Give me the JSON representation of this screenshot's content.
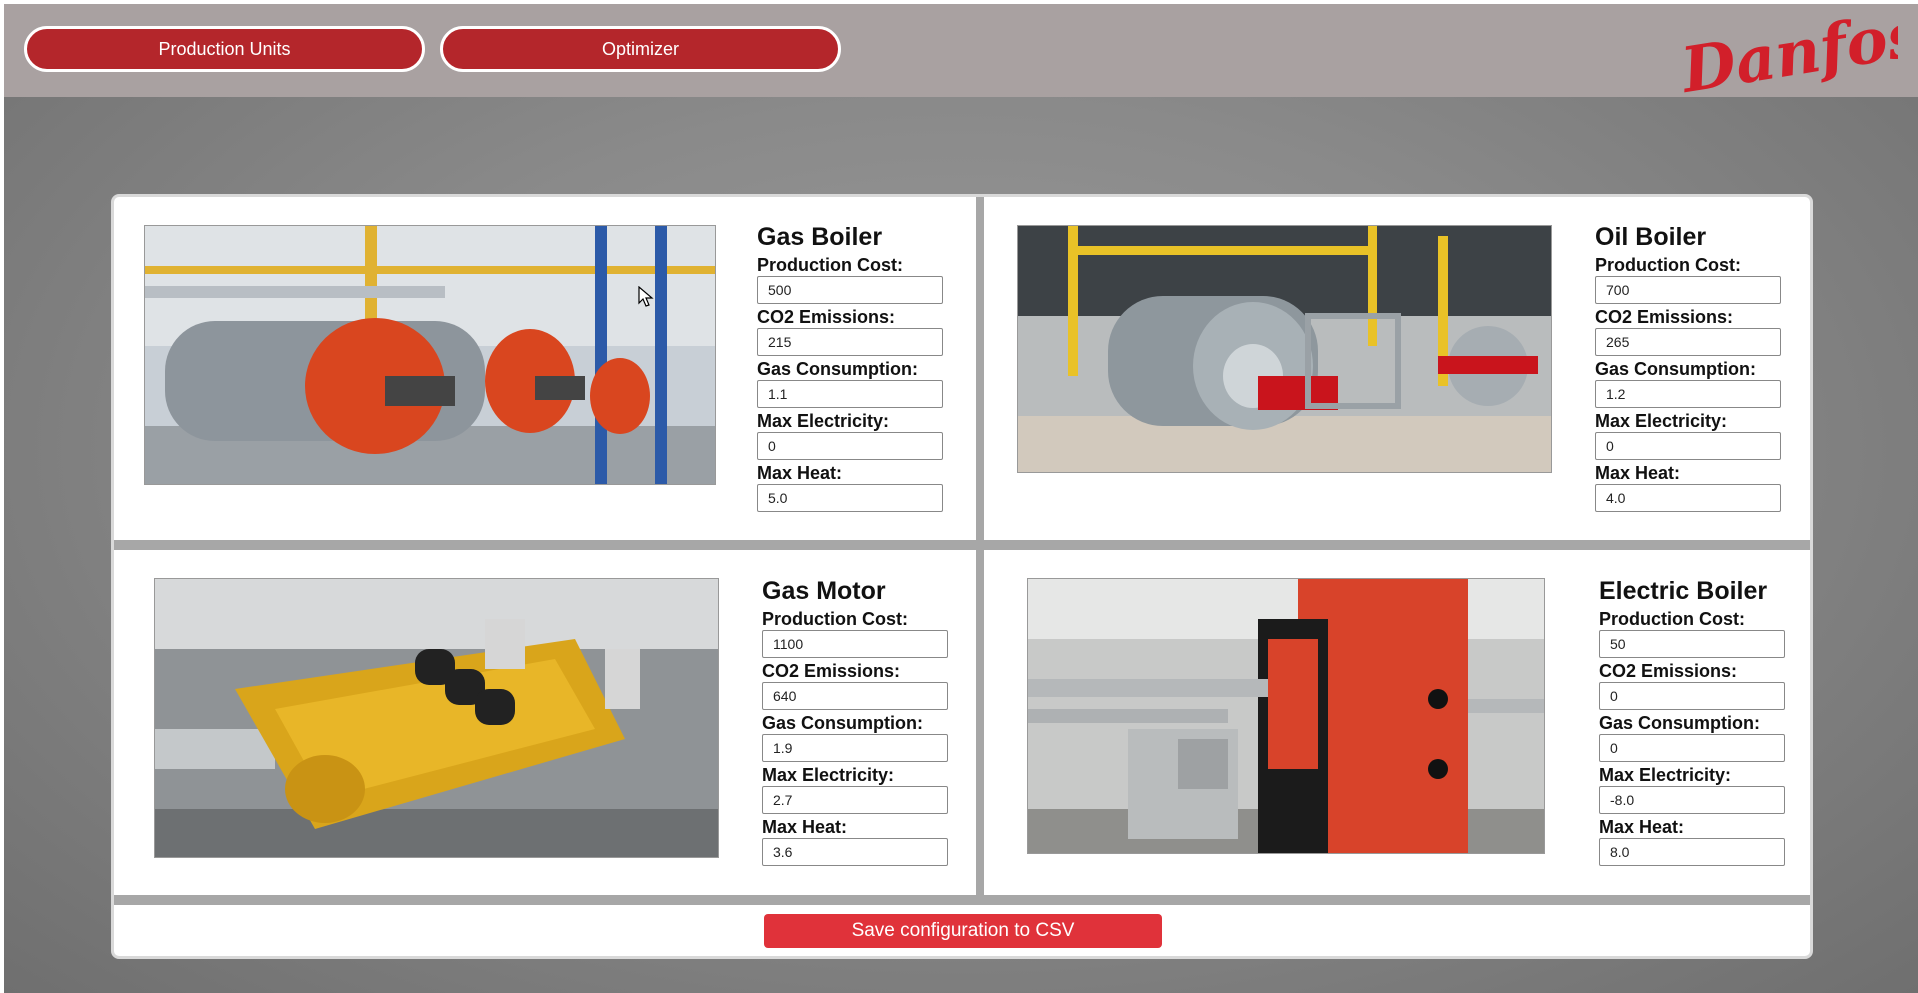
{
  "nav": {
    "production_units_label": "Production Units",
    "optimizer_label": "Optimizer"
  },
  "brand": {
    "logo_text": "Danfoss",
    "accent": "#b4262b"
  },
  "units": [
    {
      "name": "Gas Boiler",
      "fields": [
        {
          "label": "Production Cost:",
          "value": "500"
        },
        {
          "label": "CO2 Emissions:",
          "value": "215"
        },
        {
          "label": "Gas Consumption:",
          "value": "1.1"
        },
        {
          "label": "Max Electricity:",
          "value": "0"
        },
        {
          "label": "Max Heat:",
          "value": "5.0"
        }
      ]
    },
    {
      "name": "Oil Boiler",
      "fields": [
        {
          "label": "Production Cost:",
          "value": "700"
        },
        {
          "label": "CO2 Emissions:",
          "value": "265"
        },
        {
          "label": "Gas Consumption:",
          "value": "1.2"
        },
        {
          "label": "Max Electricity:",
          "value": "0"
        },
        {
          "label": "Max Heat:",
          "value": "4.0"
        }
      ]
    },
    {
      "name": "Gas Motor",
      "fields": [
        {
          "label": "Production Cost:",
          "value": "1100"
        },
        {
          "label": "CO2 Emissions:",
          "value": "640"
        },
        {
          "label": "Gas Consumption:",
          "value": "1.9"
        },
        {
          "label": "Max Electricity:",
          "value": "2.7"
        },
        {
          "label": "Max Heat:",
          "value": "3.6"
        }
      ]
    },
    {
      "name": "Electric Boiler",
      "fields": [
        {
          "label": "Production Cost:",
          "value": "50"
        },
        {
          "label": "CO2 Emissions:",
          "value": "0"
        },
        {
          "label": "Gas Consumption:",
          "value": "0"
        },
        {
          "label": "Max Electricity:",
          "value": "-8.0"
        },
        {
          "label": "Max Heat:",
          "value": "8.0"
        }
      ]
    }
  ],
  "save": {
    "label": "Save configuration to CSV"
  }
}
